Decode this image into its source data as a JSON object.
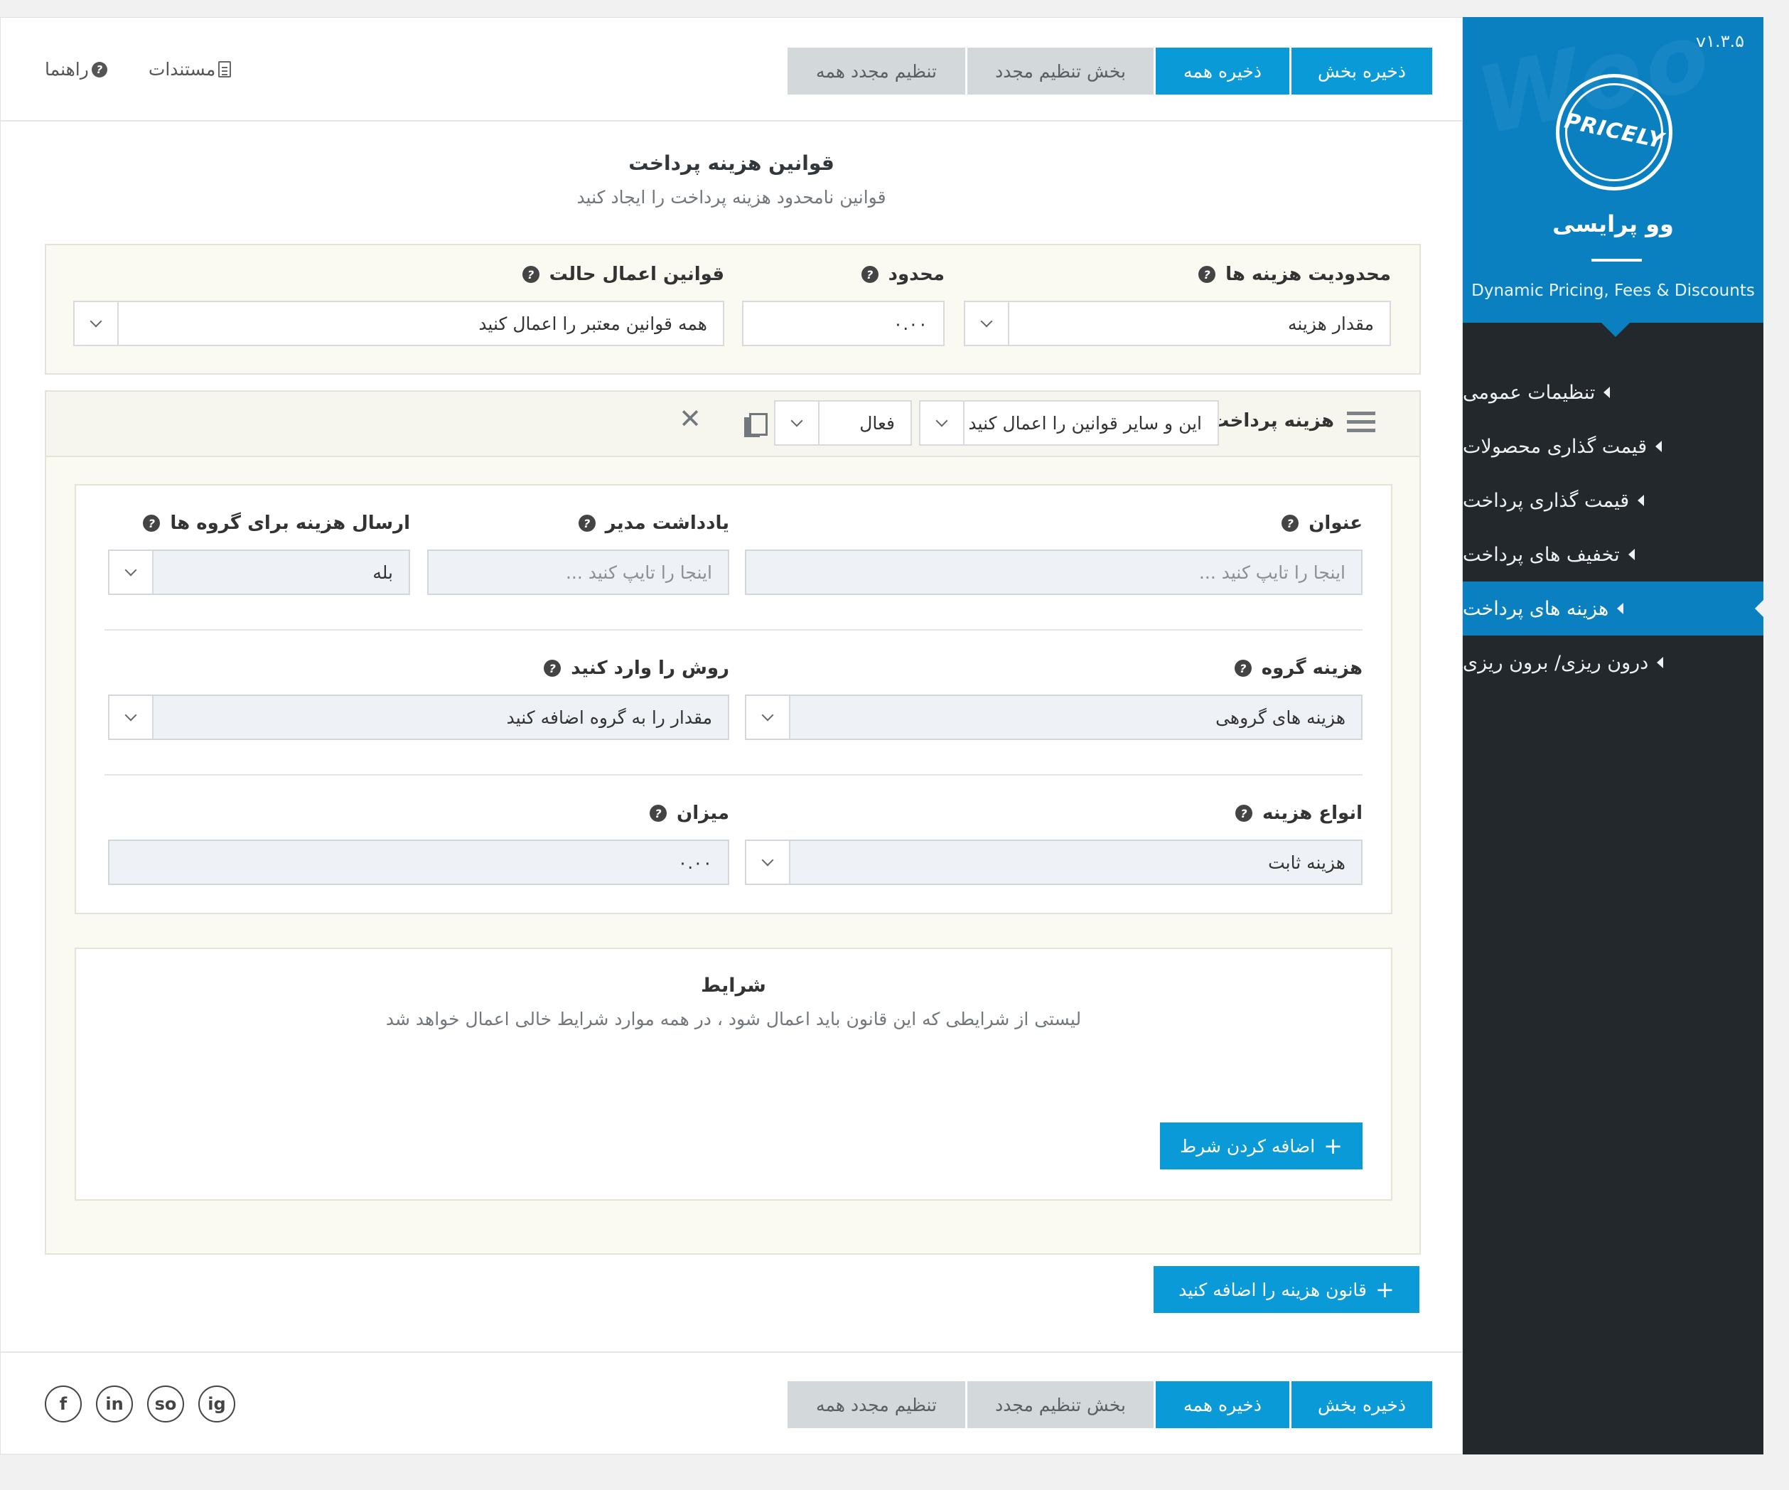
{
  "sidebar": {
    "version": "v۱.۳.۵",
    "logo_text": "PRICELY",
    "brand_name": "وو پرایسی",
    "tagline": "Dynamic Pricing, Fees & Discounts",
    "items": [
      {
        "label": "تنظیمات عمومی"
      },
      {
        "label": "قیمت گذاری محصولات"
      },
      {
        "label": "قیمت گذاری پرداخت"
      },
      {
        "label": "تخفیف های پرداخت"
      },
      {
        "label": "هزینه های پرداخت"
      },
      {
        "label": "درون ریزی/ برون ریزی"
      }
    ]
  },
  "toolbar": {
    "save_section": "ذخیره بخش",
    "save_all": "ذخیره همه",
    "reset_section": "بخش تنظیم مجدد",
    "reset_all": "تنظیم مجدد همه",
    "docs": "مستندات",
    "help": "راهنما"
  },
  "section": {
    "title": "قوانین هزینه پرداخت",
    "description": "قوانین نامحدود هزینه پرداخت را ایجاد کنید"
  },
  "limits": {
    "fee_limit_label": "محدودیت هزینه ها",
    "fee_limit_value": "مقدار هزینه",
    "limit_label": "محدود",
    "limit_value": "۰.۰۰",
    "apply_mode_label": "قوانین اعمال حالت",
    "apply_mode_value": "همه قوانین معتبر را اعمال کنید"
  },
  "rule": {
    "title": "هزینه پرداخت",
    "apply_value": "این و سایر قوانین را اعمال کنید",
    "status_value": "فعال",
    "fields": {
      "title_label": "عنوان",
      "title_placeholder": "اینجا را تایپ کنید ...",
      "admin_note_label": "یادداشت مدیر",
      "admin_note_placeholder": "اینجا را تایپ کنید ...",
      "group_send_label": "ارسال هزینه برای گروه ها",
      "group_send_value": "بله",
      "group_fee_label": "هزینه گروه",
      "group_fee_value": "هزینه های گروهی",
      "method_label": "روش را وارد کنید",
      "method_value": "مقدار را به گروه اضافه کنید",
      "fee_type_label": "انواع هزینه",
      "fee_type_value": "هزینه ثابت",
      "amount_label": "میزان",
      "amount_value": "۰.۰۰"
    },
    "conditions": {
      "title": "شرایط",
      "description": "لیستی از شرایطی که این قانون باید اعمال شود ، در همه موارد شرایط خالی اعمال خواهد شد",
      "add_button": "اضافه کردن شرط"
    }
  },
  "add_rule_button": "قانون هزینه را اضافه کنید",
  "social": [
    "f",
    "in",
    "so",
    "ig"
  ]
}
